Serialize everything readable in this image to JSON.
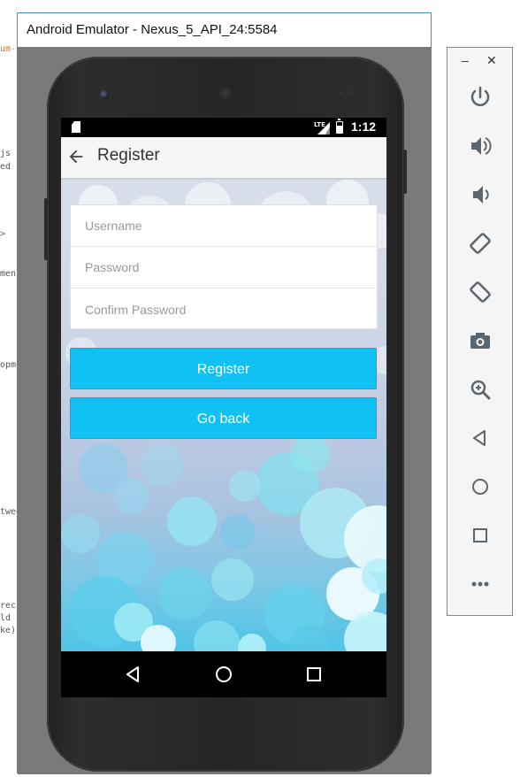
{
  "ide_fragments": [
    "um-",
    "js",
    "ed",
    ">",
    "ment",
    "opme",
    "twee",
    "rec",
    "ld",
    "ke)"
  ],
  "window": {
    "title": "Android Emulator - Nexus_5_API_24:5584",
    "border_color": "#3c8fd6"
  },
  "status_bar": {
    "network": "LTE",
    "time": "1:12"
  },
  "app_bar": {
    "title": "Register",
    "back_icon": "arrow-back-icon"
  },
  "form": {
    "username": {
      "placeholder": "Username",
      "value": ""
    },
    "password": {
      "placeholder": "Password",
      "value": ""
    },
    "confirm_password": {
      "placeholder": "Confirm Password",
      "value": ""
    }
  },
  "buttons": {
    "register": "Register",
    "go_back": "Go back"
  },
  "colors": {
    "accent": "#11c1f3",
    "app_bar_bg": "#f6f6f6"
  },
  "nav_bar": [
    "back-triangle-icon",
    "home-circle-icon",
    "recents-square-icon"
  ],
  "extended_controls": {
    "minimize": "–",
    "close": "✕",
    "icons": [
      "power-icon",
      "volume-up-icon",
      "volume-down-icon",
      "rotate-left-icon",
      "rotate-right-icon",
      "camera-icon",
      "zoom-icon",
      "back-icon",
      "home-icon",
      "overview-icon",
      "more-icon"
    ]
  }
}
